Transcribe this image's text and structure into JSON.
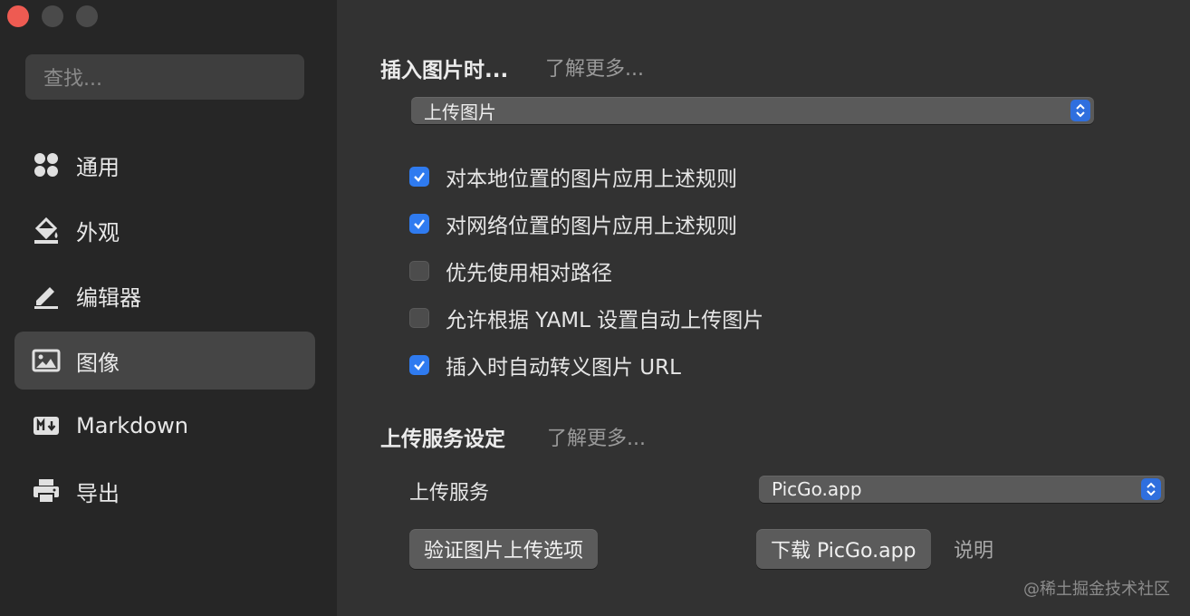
{
  "search": {
    "placeholder": "查找..."
  },
  "sidebar": {
    "items": [
      {
        "label": "通用",
        "icon": "grid-icon"
      },
      {
        "label": "外观",
        "icon": "paint-bucket-icon"
      },
      {
        "label": "编辑器",
        "icon": "pencil-icon"
      },
      {
        "label": "图像",
        "icon": "image-icon",
        "active": true
      },
      {
        "label": "Markdown",
        "icon": "markdown-icon"
      },
      {
        "label": "导出",
        "icon": "printer-icon"
      }
    ]
  },
  "insert": {
    "title": "插入图片时...",
    "learn_more": "了解更多...",
    "select_value": "上传图片",
    "options": [
      {
        "label": "对本地位置的图片应用上述规则",
        "checked": true
      },
      {
        "label": "对网络位置的图片应用上述规则",
        "checked": true
      },
      {
        "label": "优先使用相对路径",
        "checked": false
      },
      {
        "label": "允许根据 YAML 设置自动上传图片",
        "checked": false
      },
      {
        "label": "插入时自动转义图片 URL",
        "checked": true
      }
    ]
  },
  "upload": {
    "title": "上传服务设定",
    "learn_more": "了解更多...",
    "service_label": "上传服务",
    "service_value": "PicGo.app",
    "verify_button": "验证图片上传选项",
    "download_button": "下载 PicGo.app",
    "help_link": "说明"
  },
  "watermark": "@稀土掘金技术社区",
  "colors": {
    "accent": "#2f7bf0",
    "close": "#ee5b52"
  }
}
